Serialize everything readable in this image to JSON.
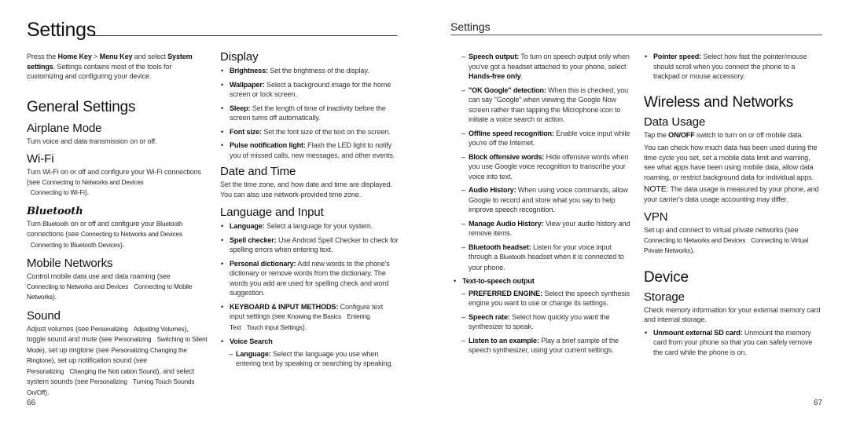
{
  "left_page": {
    "title": "Settings",
    "page_number": "66",
    "intro": {
      "t1": "Press the ",
      "b1": "Home Key",
      "t2": " > ",
      "b2": "Menu Key",
      "t3": " and select ",
      "b3": "System settings",
      "t4": ". Settings contains most of the tools for customizing and configuring your device."
    },
    "general_settings": {
      "heading": "General Settings",
      "airplane": {
        "heading": "Airplane Mode",
        "text": "Turn voice and data transmission on or off."
      },
      "wifi": {
        "heading": "Wi-Fi",
        "text": "Turn Wi-Fi on or off and configure your Wi-Fi connections (see ",
        "xref1": "Connecting to Networks and Devices",
        "xref2": "Connecting to Wi-Fi",
        "end": ")."
      },
      "bluetooth": {
        "heading": "Bluetooth",
        "t1": "Turn ",
        "x0": "Bluetooth",
        "t2": " on or off and configure your ",
        "x00": "Bluetooth",
        "t3": " connections (see ",
        "xref1": "Connecting to Networks and Devices",
        "xref2": "Connecting to Bluetooth Devices",
        "end": ")."
      },
      "mobile": {
        "heading": "Mobile Networks",
        "text": "Control mobile data use and data roaming (see ",
        "xref1": "Connecting to Networks and Devices",
        "xref2": "Connecting to Mobile Networks",
        "end": ")."
      },
      "sound": {
        "heading": "Sound",
        "t1": "Adjust volumes (see ",
        "x1": "Personalizing",
        "x2": "Adjusting Volumes",
        "t2": "), toggle sound and mute (see ",
        "x3": "Personalizing",
        "x4": "Switching to Silent Mode",
        "t3": "), set up ringtone (see ",
        "x5": "Personalizing",
        "x6": "Changing the Ringtone",
        "t4": "), set up notification sound (see ",
        "x7": "Personalizing",
        "x8": "Changing the Noti cation Sound",
        "t5": "), and select system sounds (see ",
        "x9": "Personalizing",
        "x10": "Turning Touch Sounds On/Off",
        "t6": ")."
      }
    },
    "display": {
      "heading": "Display",
      "items": [
        {
          "label": "Brightness:",
          "text": " Set the brightness of the display."
        },
        {
          "label": "Wallpaper:",
          "text": " Select a background image for the home screen or lock screen."
        },
        {
          "label": "Sleep:",
          "text": " Set the length of time of inactivity before the screen turns off automatically."
        },
        {
          "label": "Font size:",
          "text": " Set the font size of the text on the screen."
        },
        {
          "label": "Pulse notification light:",
          "text": " Flash the LED light to notify you of missed calls, new messages, and other events."
        }
      ]
    },
    "date_time": {
      "heading": "Date and Time",
      "text": "Set the time zone, and how date and time are displayed. You can also use network-provided time zone."
    },
    "language_input": {
      "heading": "Language and Input",
      "items": [
        {
          "label": "Language:",
          "text": " Select a language for your system."
        },
        {
          "label": "Spell checker:",
          "text": " Use Android Spell Checker to check for spelling errors when entering text."
        },
        {
          "label": "Personal dictionary:",
          "text": " Add new words to the phone's dictionary or remove words from the dictionary. The words you add are used for spelling check and word suggestion."
        }
      ],
      "keyboard": {
        "label": "KEYBOARD & INPUT METHODS:",
        "text": " Configure text input settings (see ",
        "x1": "Knowing the Basics",
        "x2": "Entering Text",
        "x3": "Touch Input Settings",
        "end": ")."
      },
      "voice_search": {
        "label": "Voice Search",
        "sub_label": "Language:",
        "sub_text": " Select the language you use when entering text by speaking or searching by speaking."
      }
    }
  },
  "right_page": {
    "running_header": "Settings",
    "page_number": "67",
    "voice_items": [
      {
        "label": "Speech output:",
        "text": " To turn on speech output only when you've got a headset attached to your phone, select ",
        "bold_end": "Hands-free only",
        "end": "."
      },
      {
        "label": "\"OK Google\" detection:",
        "text": " When this is checked, you can say \"Google\" when viewing the Google Now screen rather than tapping the Microphone icon to initiate a voice search or action."
      },
      {
        "label": "Offline speed recognition:",
        "text": " Enable voice input while you're off the Internet."
      },
      {
        "label": "Block offensive words:",
        "text": " Hide offensive words when you use Google voice recognition to transcribe your voice into text."
      },
      {
        "label": "Audio History:",
        "text": " When using voice commands, allow Google to record and store what you say to help improve speech recognition."
      },
      {
        "label": "Manage Audio History:",
        "text": " View your audio history and remove items."
      },
      {
        "label": "Bluetooth headset:",
        "text": " Listen for your voice input through a ",
        "x": "Bluetooth",
        "end": " headset when it is connected to your phone."
      }
    ],
    "tts": {
      "label": "Text-to-speech output",
      "items": [
        {
          "label": "PREFERRED ENGINE:",
          "text": " Select the speech synthesis engine you want to use or change its settings."
        },
        {
          "label": "Speech rate:",
          "text": " Select how quickly you want the synthesizer to speak."
        },
        {
          "label": "Listen to an example:",
          "text": " Play a brief sample of the speech synthesizer, using your current settings."
        }
      ]
    },
    "pointer": {
      "label": "Pointer speed:",
      "text": " Select how fast the pointer/mouse should scroll when you connect the phone to a trackpad or mouse accessory."
    },
    "wireless": {
      "heading": "Wireless and Networks",
      "data_usage": {
        "heading": "Data Usage",
        "t1": "Tap the ",
        "b1": "ON/OFF",
        "t2": " switch to turn on or off mobile data.",
        "p2": "You can check how much data has been used during the time cycle you set, set a mobile data limit and warning, see what apps have been using mobile data, allow data roaming, or restrict background data for individual apps.",
        "note_label": "NOTE:",
        "note": " The data usage is measured by your phone, and your carrier's data usage accounting may differ."
      },
      "vpn": {
        "heading": "VPN",
        "text": "Set up and connect to virtual private networks (see ",
        "xref1": "Connecting to Networks and Devices",
        "xref2": "Connecting to Virtual Private Networks",
        "end": ")."
      }
    },
    "device": {
      "heading": "Device",
      "storage": {
        "heading": "Storage",
        "text": "Check memory information for your external memory card and internal storage.",
        "item": {
          "label": "Unmount external SD card:",
          "text": " Unmount the memory card from your phone so that you can safely remove the card while the phone is on."
        }
      }
    }
  }
}
